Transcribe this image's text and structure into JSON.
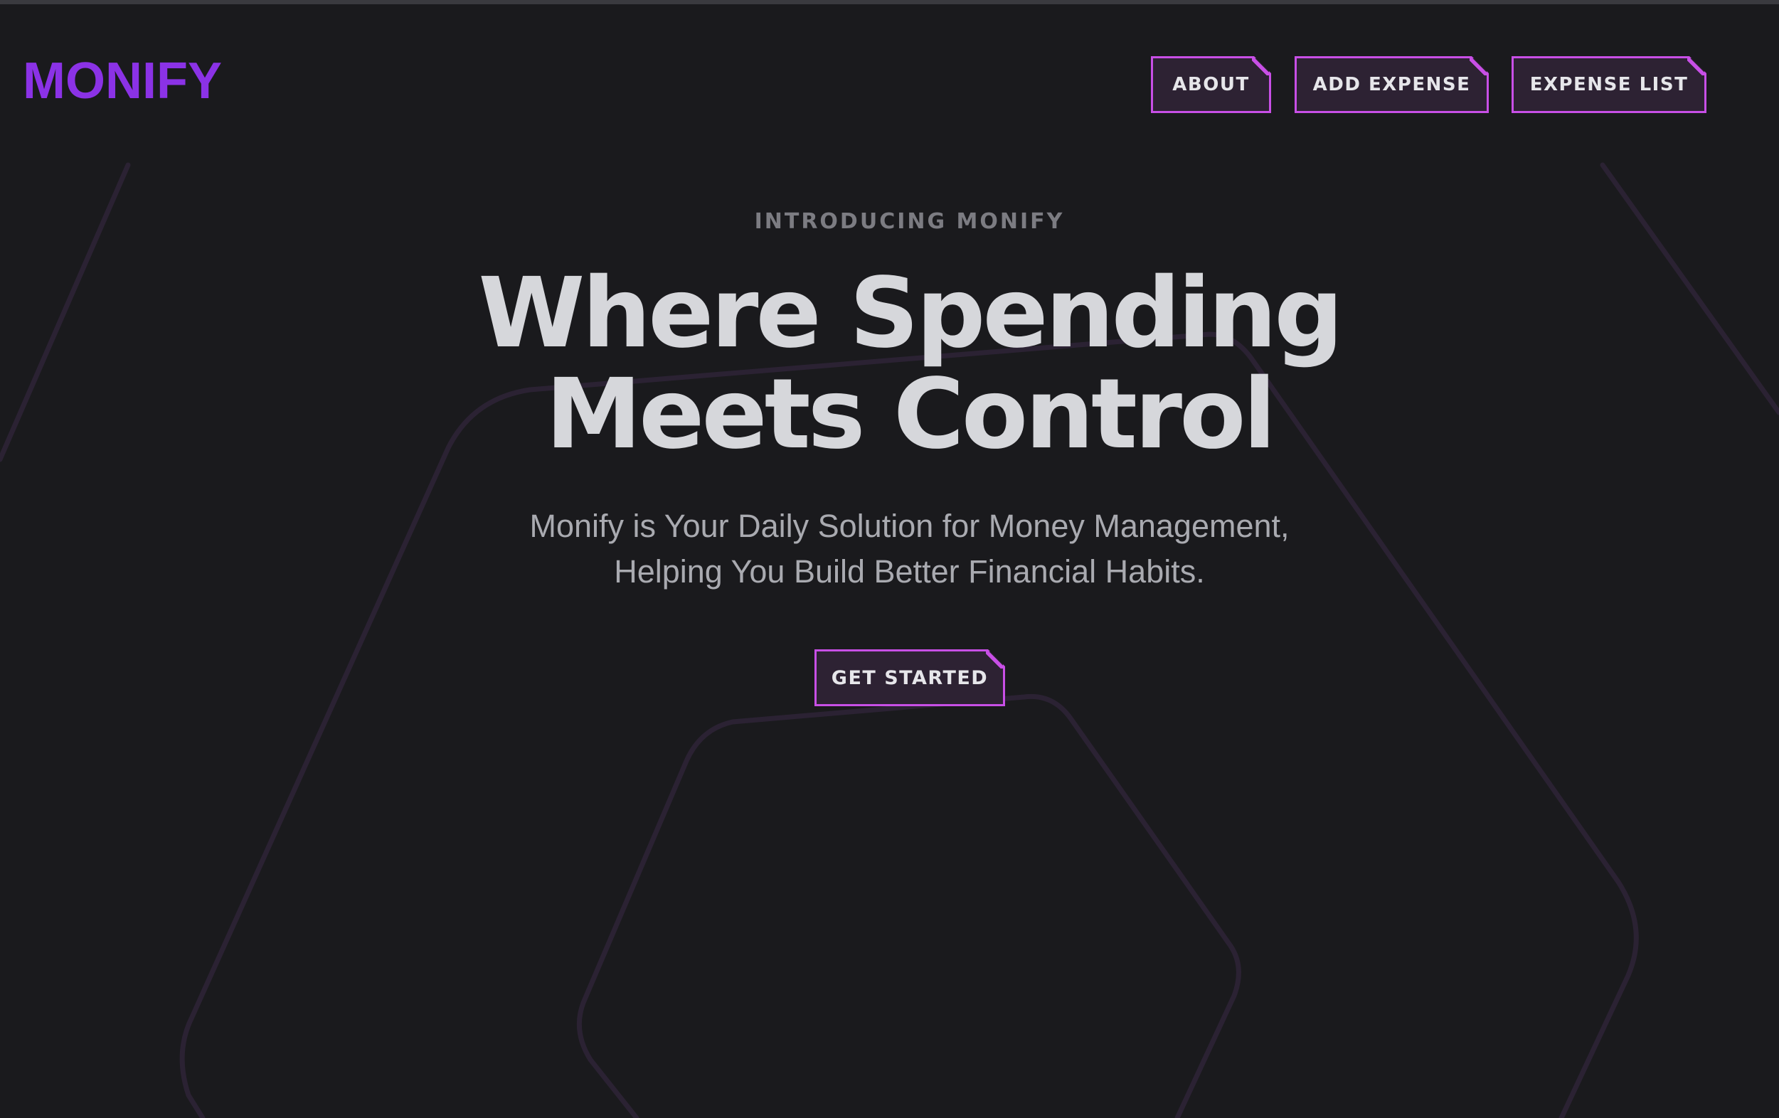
{
  "header": {
    "brand": "MONIFY",
    "nav": [
      {
        "label": "ABOUT"
      },
      {
        "label": "ADD EXPENSE"
      },
      {
        "label": "EXPENSE LIST"
      }
    ]
  },
  "hero": {
    "eyebrow": "INTRODUCING MONIFY",
    "headline_line1": "Where Spending",
    "headline_line2": "Meets Control",
    "subtitle_line1": "Monify is Your Daily Solution for Money Management,",
    "subtitle_line2": "Helping You Build Better Financial Habits.",
    "cta_label": "GET STARTED"
  },
  "colors": {
    "background": "#1a1a1d",
    "brand": "#8b32e6",
    "accent_border": "#c84fe6",
    "button_fill": "#2d2233",
    "headline": "#d6d7db",
    "subtitle": "#a9aab0",
    "eyebrow": "#7c7c82",
    "decor_lines": "#2b2233"
  }
}
